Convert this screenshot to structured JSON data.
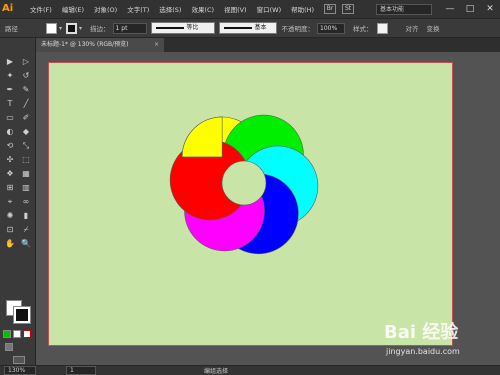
{
  "app": {
    "logo": "Ai"
  },
  "menu": [
    "文件(F)",
    "编辑(E)",
    "对象(O)",
    "文字(T)",
    "选择(S)",
    "效果(C)",
    "视图(V)",
    "窗口(W)",
    "帮助(H)"
  ],
  "menubar_right": {
    "icon1": "Br",
    "icon2": "St",
    "workspace": "基本功能",
    "minimize": "—",
    "maximize": "□",
    "close": "✕"
  },
  "control": {
    "label": "路径",
    "stroke_label": "描边：",
    "stroke_value": "1 pt",
    "profile_label": "等比",
    "brush_label": "基本",
    "opacity_label": "不透明度：",
    "opacity_value": "100%",
    "style_label": "样式：",
    "align_label": "对齐",
    "transform_label": "变换"
  },
  "document": {
    "tab_title": "未标题-1* @ 130% (RGB/预览)",
    "close": "×"
  },
  "tools": [
    "▶",
    "▷",
    "✦",
    "↺",
    "✒",
    "✎",
    "T",
    "╱",
    "▭",
    "✐",
    "◐",
    "◆",
    "⟲",
    "⤡",
    "✣",
    "⬚",
    "❖",
    "▦",
    "⊞",
    "▥",
    "✋",
    "🔍"
  ],
  "status": {
    "zoom": "130%",
    "page": "1",
    "mode": "编组选择"
  },
  "watermark": {
    "brand": "Bai 经验",
    "url": "jingyan.baidu.com"
  },
  "colors": {
    "artboard": "#c8e4a6",
    "petals": [
      "#ffff00",
      "#00ee00",
      "#00ffff",
      "#0000ff",
      "#ff00ff",
      "#ff0000"
    ]
  }
}
